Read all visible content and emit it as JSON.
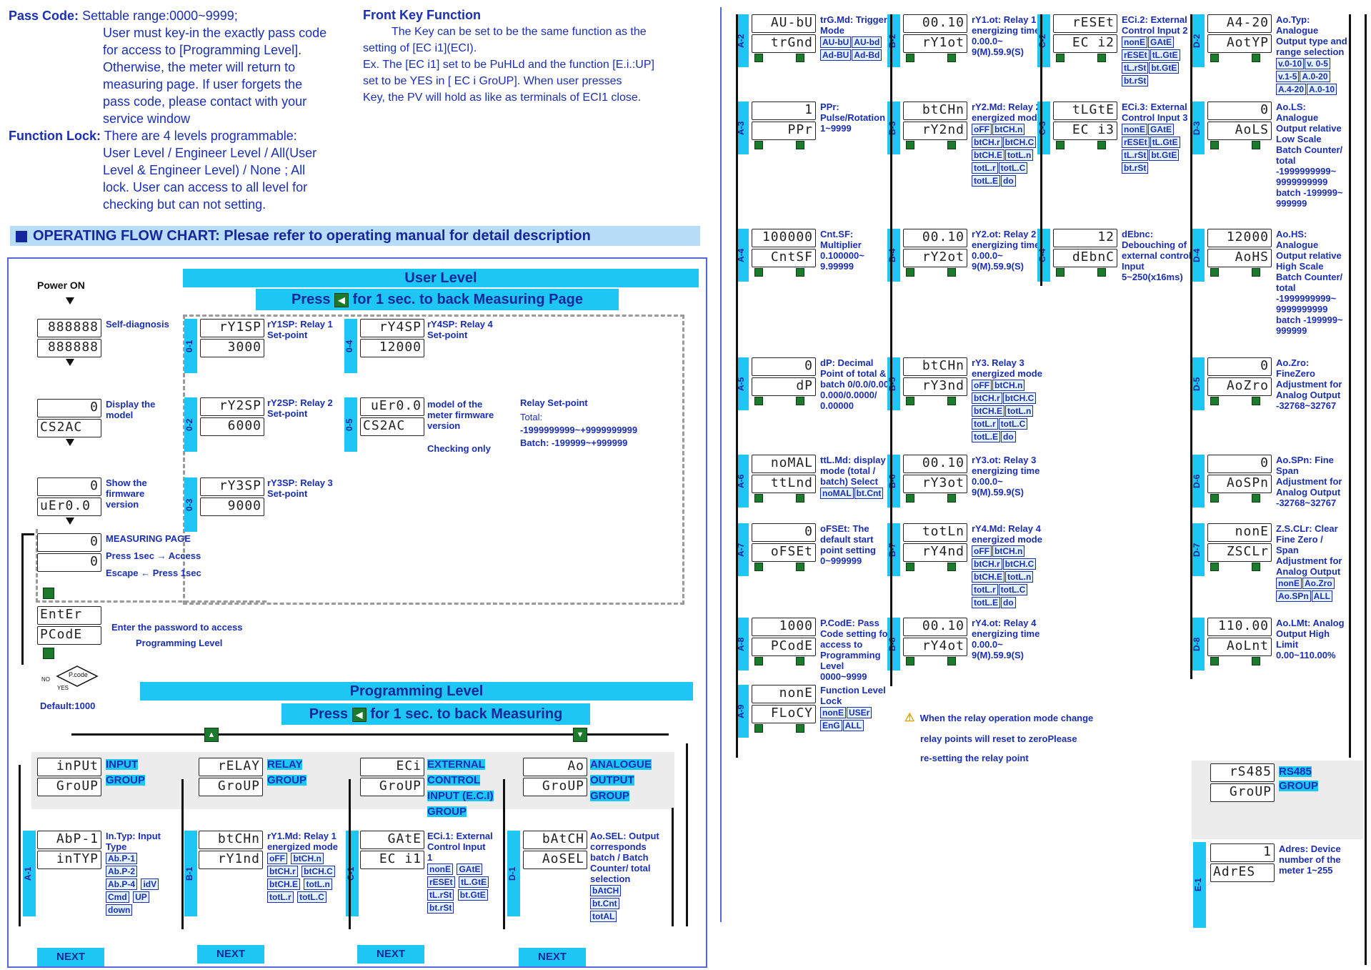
{
  "intro": {
    "pass_code_title": "Pass Code:",
    "pass_code_lines": [
      "Settable range:0000~9999;",
      "User must key-in the exactly pass code",
      "for access to [Programming Level].",
      "Otherwise, the meter will return to",
      "measuring page. If user forgets the",
      "pass code, please contact with your",
      "service window"
    ],
    "function_lock_title": "Function Lock:",
    "function_lock_lines": [
      "There are 4 levels programmable:",
      "User Level / Engineer Level / All(User",
      "Level & Engineer Level) / None ; All",
      "lock. User can access to all level for",
      "checking but can not setting."
    ],
    "front_key_title": "Front Key Function",
    "front_key_lines": [
      "The  Key can be set to be the same function as the",
      "setting of [EC i1](ECI).",
      "Ex. The [EC i1] set to be PuHLd and the function [E.i.:UP]",
      "set to be  YES  in [ EC i GroUP]. When user presses",
      " Key, the PV will hold as like as terminals of ECI1 close."
    ]
  },
  "flow_title": "OPERATING FLOW CHART: Plesae refer to operating manual for detail description",
  "user_level": {
    "title": "User Level",
    "press_text": "Press",
    "press_suffix": "for 1 sec. to back Measuring Page",
    "power_on": "Power ON",
    "self_diag": "Self-diagnosis",
    "display_model": "Display the model",
    "show_fw": "Show the firmware version",
    "measuring_page": "MEASURING PAGE",
    "press_access": "Press  1sec → Access",
    "escape": "Escape ← Press  1sec",
    "enter_pw": "Enter the password to access",
    "prog_level": "Programming Level",
    "default": "Default:1000",
    "pcode": "P.code",
    "no": "NO",
    "yes": "YES",
    "relay_setpoint_title": "Relay Set-point",
    "relay_total": "Total:",
    "relay_total_range": "-1999999999~+9999999999",
    "relay_batch": "Batch: -199999~+999999",
    "lcds": [
      {
        "top": "888888",
        "bot": "888888"
      },
      {
        "top": "0",
        "bot": "CS2AC"
      },
      {
        "top": "0",
        "bot": "uEr0.0"
      },
      {
        "top": "0",
        "bot": "0"
      },
      {
        "top": "EntEr",
        "bot": "PCodE"
      }
    ],
    "setpoints": [
      {
        "tab": "0-1",
        "code": "rY1SP",
        "top": "rY1SP",
        "bot": "3000",
        "label": "rY1SP: Relay 1 Set-point"
      },
      {
        "tab": "0-2",
        "code": "rY2SP",
        "top": "rY2SP",
        "bot": "6000",
        "label": "rY2SP: Relay 2 Set-point"
      },
      {
        "tab": "0-3",
        "code": "rY3SP",
        "top": "rY3SP",
        "bot": "9000",
        "label": "rY3SP: Relay 3 Set-point"
      },
      {
        "tab": "0-4",
        "code": "rY4SP",
        "top": "rY4SP",
        "bot": "12000",
        "label": "rY4SP: Relay 4 Set-point"
      },
      {
        "tab": "0-5",
        "code": "uEr0.0",
        "top": "uEr0.0",
        "bot": "CS2AC",
        "label": "model of the meter firmware version",
        "extra": "Checking only"
      }
    ]
  },
  "prog_level": {
    "title": "Programming Level",
    "press_text": "Press",
    "press_suffix": "for 1 sec. to back Measuring",
    "groups": [
      {
        "top": "inPUt",
        "bot": "GroUP",
        "label1": "INPUT",
        "label2": "GROUP"
      },
      {
        "top": "rELAY",
        "bot": "GroUP",
        "label1": "RELAY",
        "label2": "GROUP"
      },
      {
        "top": "ECi",
        "bot": "GroUP",
        "label1": "EXTERNAL",
        "label2": "CONTROL",
        "label3": "INPUT (E.C.I)",
        "label4": "GROUP"
      },
      {
        "top": "Ao",
        "bot": "GroUP",
        "label1": "ANALOGUE",
        "label2": "OUTPUT",
        "label3": "GROUP"
      }
    ],
    "first_items": [
      {
        "tab": "A-1",
        "top": "AbP-1",
        "bot": "inTYP",
        "label": "In.Typ: Input Type",
        "opts": [
          "Ab.P-1",
          "Ab.P-2",
          "Ab.P-4",
          "idV",
          "Cmd",
          "UP",
          "down"
        ]
      },
      {
        "tab": "B-1",
        "top": "btCHn",
        "bot": "rY1nd",
        "label": "rY1.Md: Relay 1 energized mode",
        "opts": [
          "oFF",
          "btCH.n",
          "btCH.r",
          "btCH.C",
          "btCH.E",
          "totL.n",
          "totL.r",
          "totL.C"
        ]
      },
      {
        "tab": "C-1",
        "top": "GAtE",
        "bot": "EC i1",
        "label": "ECi.1: External Control Input 1",
        "opts": [
          "nonE",
          "GAtE",
          "rESEt",
          "tL.GtE",
          "tL.rSt",
          "bt.GtE",
          "bt.rSt"
        ]
      },
      {
        "tab": "D-1",
        "top": "bAtCH",
        "bot": "AoSEL",
        "label": "Ao.SEL: Output corresponds batch / Batch Counter/ total selection",
        "opts": [
          "bAtCH",
          "bt.Cnt",
          "totAL"
        ]
      }
    ],
    "next": "NEXT"
  },
  "col_a": [
    {
      "tab": "A-2",
      "top": "AU-bU",
      "bot": "trGnd",
      "label": "trG.Md: Trigger Mode",
      "opts": [
        "AU-bU",
        "AU-bd",
        "Ad-BU",
        "Ad-Bd"
      ]
    },
    {
      "tab": "A-3",
      "top": "1",
      "bot": "PPr",
      "label": "PPr: Pulse/Rotation 1~9999",
      "opts": []
    },
    {
      "tab": "A-4",
      "top": "100000",
      "bot": "CntSF",
      "label": "Cnt.SF: Multiplier 0.100000~ 9.99999",
      "opts": []
    },
    {
      "tab": "A-5",
      "top": "0",
      "bot": "dP",
      "label": "dP: Decimal Point of total & batch 0/0.0/0.00/ 0.000/0.0000/ 0.00000",
      "opts": []
    },
    {
      "tab": "A-6",
      "top": "noMAL",
      "bot": "ttLnd",
      "label": "ttL.Md: display mode (total / batch) Select",
      "opts": [
        "noMAL",
        "bt.Cnt"
      ]
    },
    {
      "tab": "A-7",
      "top": "0",
      "bot": "oFSEt",
      "label": "oFSEt: The default start point setting 0~999999",
      "opts": []
    },
    {
      "tab": "A-8",
      "top": "1000",
      "bot": "PCodE",
      "label": "P.CodE: Pass Code setting for access to Programming Level 0000~9999",
      "opts": []
    },
    {
      "tab": "A-9",
      "top": "nonE",
      "bot": "FLoCY",
      "label": "Function Level Lock",
      "opts": [
        "nonE",
        "USEr",
        "EnG",
        "ALL"
      ]
    }
  ],
  "col_b": [
    {
      "tab": "B-2",
      "top": "00.10",
      "bot": "rY1ot",
      "label": "rY1.ot: Relay 1 energizing time 0.00.0~ 9(M).59.9(S)",
      "opts": []
    },
    {
      "tab": "B-3",
      "top": "btCHn",
      "bot": "rY2nd",
      "label": "rY2.Md: Relay 2 energized mode",
      "opts": [
        "oFF",
        "btCH.n",
        "btCH.r",
        "btCH.C",
        "btCH.E",
        "totL.n",
        "totL.r",
        "totL.C",
        "totL.E",
        "do"
      ]
    },
    {
      "tab": "B-4",
      "top": "00.10",
      "bot": "rY2ot",
      "label": "rY2.ot: Relay 2 energizing time 0.00.0~ 9(M).59.9(S)",
      "opts": []
    },
    {
      "tab": "B-5",
      "top": "btCHn",
      "bot": "rY3nd",
      "label": "rY3. Relay 3 energized mode",
      "opts": [
        "oFF",
        "btCH.n",
        "btCH.r",
        "btCH.C",
        "btCH.E",
        "totL.n",
        "totL.r",
        "totL.C",
        "totL.E",
        "do"
      ]
    },
    {
      "tab": "B-6",
      "top": "00.10",
      "bot": "rY3ot",
      "label": "rY3.ot: Relay 3 energizing time 0.00.0~ 9(M).59.9(S)",
      "opts": []
    },
    {
      "tab": "B-7",
      "top": "totLn",
      "bot": "rY4nd",
      "label": "rY4.Md: Relay 4 energized mode",
      "opts": [
        "oFF",
        "btCH.n",
        "btCH.r",
        "btCH.C",
        "btCH.E",
        "totL.n",
        "totL.r",
        "totL.C",
        "totL.E",
        "do"
      ]
    },
    {
      "tab": "B-8",
      "top": "00.10",
      "bot": "rY4ot",
      "label": "rY4.ot: Relay 4 energizing time 0.00.0~ 9(M).59.9(S)",
      "opts": []
    }
  ],
  "col_c": [
    {
      "tab": "C-2",
      "top": "rESEt",
      "bot": "EC i2",
      "label": "ECi.2: External Control Input 2",
      "opts": [
        "nonE",
        "GAtE",
        "rESEt",
        "tL.GtE",
        "tL.rSt",
        "bt.GtE",
        "bt.rSt"
      ]
    },
    {
      "tab": "C-3",
      "top": "tLGtE",
      "bot": "EC i3",
      "label": "ECi.3: External Control Input 3",
      "opts": [
        "nonE",
        "GAtE",
        "rESEt",
        "tL.GtE",
        "tL.rSt",
        "bt.GtE",
        "bt.rSt"
      ]
    },
    {
      "tab": "C-4",
      "top": "12",
      "bot": "dEbnC",
      "label": "dEbnc: Debouching of external control Input 5~250(x16ms)",
      "opts": []
    }
  ],
  "col_d": [
    {
      "tab": "D-2",
      "top": "A4-20",
      "bot": "AotYP",
      "label": "Ao.Typ: Analogue Output type and range selection",
      "opts": [
        "v.0-10",
        "v. 0-5",
        "v.1-5",
        "A.0-20",
        "A.4-20",
        "A.0-10"
      ]
    },
    {
      "tab": "D-3",
      "top": "0",
      "bot": "AoLS",
      "label": "Ao.LS: Analogue Output relative Low Scale Batch Counter/ total -1999999999~ 9999999999 batch -199999~ 999999",
      "opts": []
    },
    {
      "tab": "D-4",
      "top": "12000",
      "bot": "AoHS",
      "label": "Ao.HS: Analogue Output relative High Scale Batch Counter/ total -1999999999~ 9999999999 batch -199999~ 999999",
      "opts": []
    },
    {
      "tab": "D-5",
      "top": "0",
      "bot": "AoZro",
      "label": "Ao.Zro: FineZero Adjustment for Analog Output -32768~32767",
      "opts": []
    },
    {
      "tab": "D-6",
      "top": "0",
      "bot": "AoSPn",
      "label": "Ao.SPn: Fine Span Adjustment for Analog Output -32768~32767",
      "opts": []
    },
    {
      "tab": "D-7",
      "top": "nonE",
      "bot": "ZSCLr",
      "label": "Z.S.CLr: Clear Fine Zero / Span Adjustment for Analog Output",
      "opts": [
        "nonE",
        "Ao.Zro",
        "Ao.SPn",
        "ALL"
      ]
    },
    {
      "tab": "D-8",
      "top": "110.00",
      "bot": "AoLnt",
      "label": "Ao.LMt: Analog Output High Limit 0.00~110.00%",
      "opts": []
    }
  ],
  "rs485": {
    "top": "rS485",
    "bot": "GroUP",
    "label1": "RS485",
    "label2": "GROUP",
    "e1": {
      "tab": "E-1",
      "top": "1",
      "bot": "AdrES",
      "label": "Adres: Device number of the meter 1~255"
    }
  },
  "warning": [
    "When the relay operation mode change",
    "relay points will reset to zeroPlease",
    "re-setting the relay point"
  ]
}
